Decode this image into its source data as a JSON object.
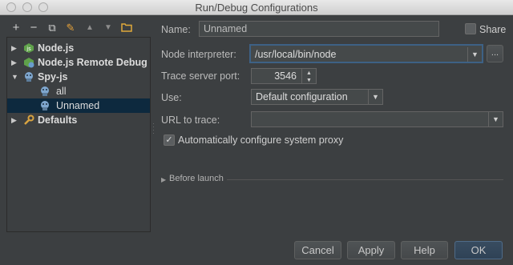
{
  "window": {
    "title": "Run/Debug Configurations"
  },
  "toolbar": {
    "add": "+",
    "remove": "−",
    "copy": "⧉",
    "edit_defaults": "✎",
    "move_up": "▲",
    "move_down": "▼",
    "folder": "📁"
  },
  "tree": {
    "items": [
      {
        "label": "Node.js",
        "expanded": false,
        "icon": "nodejs-icon"
      },
      {
        "label": "Node.js Remote Debug",
        "expanded": false,
        "icon": "nodejs-remote-icon"
      },
      {
        "label": "Spy-js",
        "expanded": true,
        "icon": "spyjs-icon"
      },
      {
        "label": "all",
        "icon": "spyjs-config-icon"
      },
      {
        "label": "Unnamed",
        "icon": "spyjs-config-icon",
        "selected": true
      },
      {
        "label": "Defaults",
        "expanded": false,
        "icon": "defaults-wrench-icon"
      }
    ]
  },
  "form": {
    "name_label": "Name:",
    "name_value": "Unnamed",
    "share_label": "Share",
    "share_checked": false,
    "node_interpreter_label": "Node interpreter:",
    "node_interpreter_value": "/usr/local/bin/node",
    "node_interpreter_more": "...",
    "trace_port_label": "Trace server port:",
    "trace_port_value": "3546",
    "use_label": "Use:",
    "use_value": "Default configuration",
    "url_label": "URL to trace:",
    "url_value": "",
    "auto_proxy_label": "Automatically configure system proxy",
    "auto_proxy_checked": true,
    "before_launch_label": "Before launch"
  },
  "buttons": {
    "cancel": "Cancel",
    "apply": "Apply",
    "help": "Help",
    "ok": "OK"
  },
  "colors": {
    "background": "#3c3f41",
    "selection": "#0d293e",
    "focus": "#3d6185"
  }
}
